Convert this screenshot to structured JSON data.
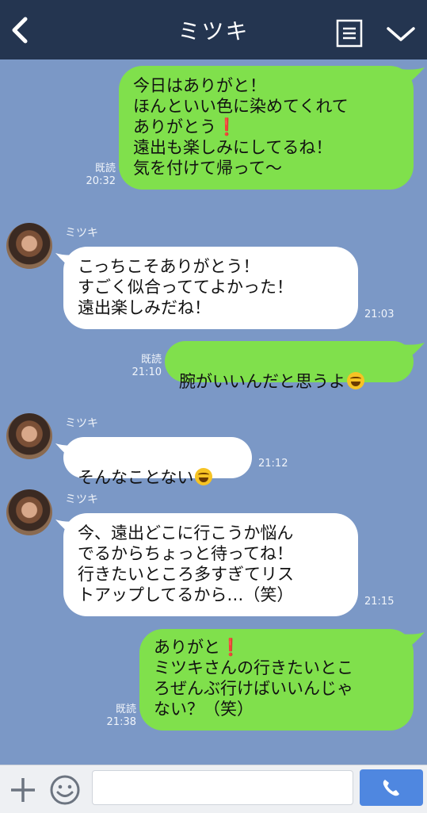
{
  "header": {
    "title": "ミツキ"
  },
  "messages": [
    {
      "side": "out",
      "text": "今日はありがと！\nほんといい色に染めてくれて\nありがとう❗\n遠出も楽しみにしてるね！\n気を付けて帰って〜",
      "read": "既読",
      "time": "20:32"
    },
    {
      "side": "in",
      "name": "ミツキ",
      "text": "こっちこそありがとう！\nすごく似合っててよかった！\n遠出楽しみだね！",
      "time": "21:03"
    },
    {
      "side": "out",
      "text": "腕がいいんだと思うよ",
      "emoji": "laughing-tears",
      "read": "既読",
      "time": "21:10"
    },
    {
      "side": "in",
      "name": "ミツキ",
      "text": "そんなことない",
      "emoji": "laughing-tears",
      "time": "21:12"
    },
    {
      "side": "in",
      "name": "ミツキ",
      "text": "今、遠出どこに行こうか悩ん\nでるからちょっと待ってね！\n行きたいところ多すぎてリス\nトアップしてるから…（笑）",
      "time": "21:15"
    },
    {
      "side": "out",
      "text": "ありがと❗\nミツキさんの行きたいとこ\nろぜんぶ行けばいいんじゃ\nない？（笑）",
      "read": "既読",
      "time": "21:38"
    }
  ],
  "composer": {
    "placeholder": ""
  },
  "colors": {
    "header": "#243550",
    "background": "#7b98c6",
    "outgoing": "#80e04c",
    "incoming": "#ffffff",
    "send": "#4f87e0"
  }
}
